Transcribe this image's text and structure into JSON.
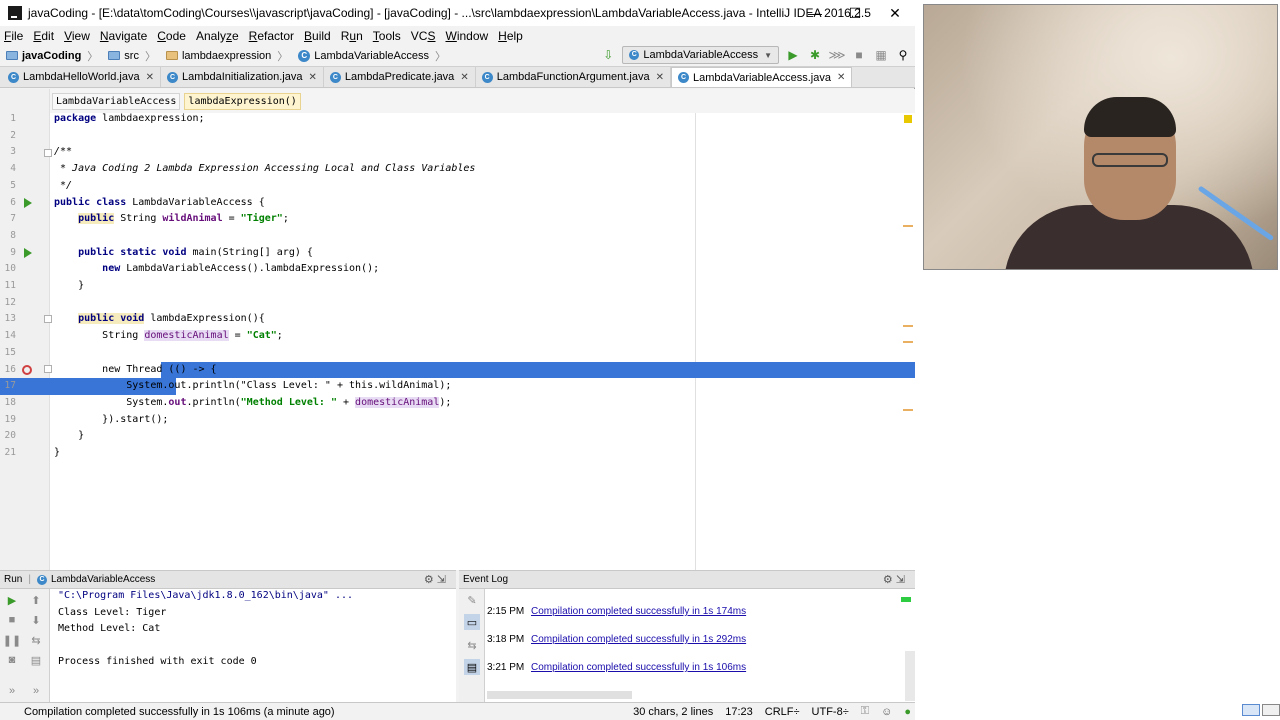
{
  "window": {
    "title": "javaCoding - [E:\\data\\tomCoding\\Courses\\\\javascript\\javaCoding] - [javaCoding] - ...\\src\\lambdaexpression\\LambdaVariableAccess.java - IntelliJ IDEA 2016.2.5",
    "minimize": "—",
    "maximize": "☐",
    "close": "✕"
  },
  "menu": [
    {
      "pre": "",
      "u": "F",
      "post": "ile"
    },
    {
      "pre": "",
      "u": "E",
      "post": "dit"
    },
    {
      "pre": "",
      "u": "V",
      "post": "iew"
    },
    {
      "pre": "",
      "u": "N",
      "post": "avigate"
    },
    {
      "pre": "",
      "u": "C",
      "post": "ode"
    },
    {
      "pre": "Analy",
      "u": "z",
      "post": "e"
    },
    {
      "pre": "",
      "u": "R",
      "post": "efactor"
    },
    {
      "pre": "",
      "u": "B",
      "post": "uild"
    },
    {
      "pre": "R",
      "u": "u",
      "post": "n"
    },
    {
      "pre": "",
      "u": "T",
      "post": "ools"
    },
    {
      "pre": "VC",
      "u": "S",
      "post": ""
    },
    {
      "pre": "",
      "u": "W",
      "post": "indow"
    },
    {
      "pre": "",
      "u": "H",
      "post": "elp"
    }
  ],
  "breadcrumb": {
    "project": "javaCoding",
    "src": "src",
    "package": "lambdaexpression",
    "class": "LambdaVariableAccess"
  },
  "run_config": "LambdaVariableAccess",
  "tabs": [
    {
      "label": "LambdaHelloWorld.java"
    },
    {
      "label": "LambdaInitialization.java"
    },
    {
      "label": "LambdaPredicate.java"
    },
    {
      "label": "LambdaFunctionArgument.java"
    },
    {
      "label": "LambdaVariableAccess.java",
      "active": true
    }
  ],
  "editor_breadcrumb": [
    "LambdaVariableAccess",
    "lambdaExpression()"
  ],
  "code_lines": [
    "1",
    "2",
    "3",
    "4",
    "5",
    "6",
    "7",
    "8",
    "9",
    "10",
    "11",
    "12",
    "13",
    "14",
    "15",
    "16",
    "17",
    "18",
    "19",
    "20",
    "21"
  ],
  "code": {
    "l1_kw": "package",
    "l1_rest": " lambdaexpression;",
    "l3": "/**",
    "l4": " * Java Coding 2 Lambda Expression Accessing Local and Class Variables",
    "l5": " */",
    "l6_kw": "public class",
    "l6_rest": " LambdaVariableAccess {",
    "l7_kw": "public",
    "l7_mid": " String ",
    "l7_fld": "wildAnimal",
    "l7_eq": " = ",
    "l7_str": "\"Tiger\"",
    "l7_end": ";",
    "l9_kw": "public static void",
    "l9_rest": " main(String[] arg) {",
    "l10_kw": "new",
    "l10_rest": " LambdaVariableAccess().lambdaExpression();",
    "l11": "}",
    "l13_kw": "public void",
    "l13_rest": " lambdaExpression(){",
    "l14_a": "String ",
    "l14_var": "domesticAnimal",
    "l14_eq": " = ",
    "l14_str": "\"Cat\"",
    "l14_end": ";",
    "l16": "new Thread (() -> {",
    "l17": "System.out.println(\"Class Level: \" + this.wildAnimal);",
    "l18_a": "System.",
    "l18_out": "out",
    "l18_b": ".println(",
    "l18_str": "\"Method Level: \"",
    "l18_plus": " + ",
    "l18_var": "domesticAnimal",
    "l18_end": ");",
    "l19": "}).start();",
    "l20": "}",
    "l21": "}"
  },
  "run_panel": {
    "title": "Run",
    "config": "LambdaVariableAccess",
    "lines": [
      "\"C:\\Program Files\\Java\\jdk1.8.0_162\\bin\\java\" ...",
      "Class Level: Tiger",
      "Method Level: Cat",
      "",
      "Process finished with exit code 0"
    ]
  },
  "event_log": {
    "title": "Event Log",
    "entries": [
      {
        "time": "2:15 PM",
        "message": "Compilation completed successfully in 1s 174ms"
      },
      {
        "time": "3:18 PM",
        "message": "Compilation completed successfully in 1s 292ms"
      },
      {
        "time": "3:21 PM",
        "message": "Compilation completed successfully in 1s 106ms"
      }
    ]
  },
  "status": {
    "message": "Compilation completed successfully in 1s 106ms (a minute ago)",
    "selection": "30 chars, 2 lines",
    "position": "17:23",
    "line_sep": "CRLF÷",
    "encoding": "UTF-8÷"
  },
  "colors": {
    "selection": "#3875d7",
    "keyword": "#000080",
    "string": "#008000",
    "field": "#660e7a",
    "link": "#1a0dab"
  }
}
